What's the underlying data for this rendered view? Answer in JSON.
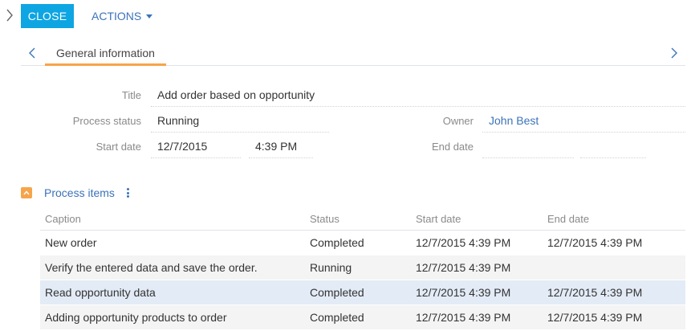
{
  "toolbar": {
    "close_label": "CLOSE",
    "actions_label": "ACTIONS"
  },
  "tabs": [
    {
      "label": "General information",
      "active": true
    }
  ],
  "fields": {
    "title": {
      "label": "Title",
      "value": "Add order based on opportunity"
    },
    "process_status": {
      "label": "Process status",
      "value": "Running"
    },
    "owner": {
      "label": "Owner",
      "value": "John Best"
    },
    "start_date": {
      "label": "Start date",
      "date": "12/7/2015",
      "time": "4:39 PM"
    },
    "end_date": {
      "label": "End date",
      "date": "",
      "time": ""
    }
  },
  "process_items": {
    "title": "Process items",
    "columns": [
      "Caption",
      "Status",
      "Start date",
      "End date"
    ],
    "rows": [
      {
        "caption": "New order",
        "status": "Completed",
        "start": "12/7/2015 4:39 PM",
        "end": "12/7/2015 4:39 PM"
      },
      {
        "caption": "Verify the entered data and save the order.",
        "status": "Running",
        "start": "12/7/2015 4:39 PM",
        "end": ""
      },
      {
        "caption": "Read opportunity data",
        "status": "Completed",
        "start": "12/7/2015 4:39 PM",
        "end": "12/7/2015 4:39 PM"
      },
      {
        "caption": "Adding opportunity products to order",
        "status": "Completed",
        "start": "12/7/2015 4:39 PM",
        "end": "12/7/2015 4:39 PM"
      }
    ]
  },
  "colors": {
    "primary_button": "#0ea5e3",
    "link": "#3b73b9",
    "accent": "#f6a44b",
    "selected_row": "#e3ebf6"
  }
}
